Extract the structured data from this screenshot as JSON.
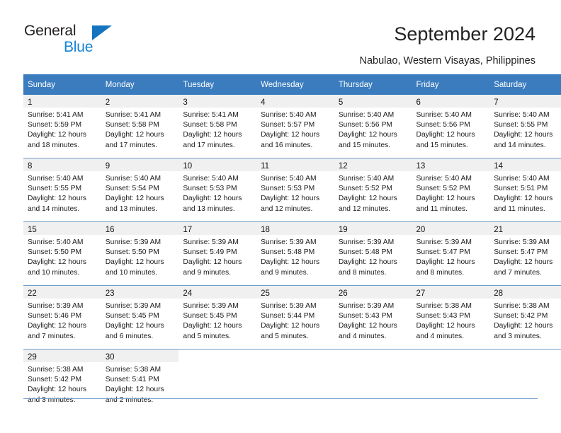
{
  "brand": {
    "name_dark": "General",
    "name_light": "Blue",
    "triangle_color": "#1673bd",
    "blue_color": "#1683d4"
  },
  "header": {
    "title": "September 2024",
    "subtitle": "Nabulao, Western Visayas, Philippines",
    "header_bg": "#3a7cbe",
    "header_text_color": "#ffffff",
    "daynum_band_bg": "#f0f0f0",
    "row_rule_color": "#6d9dcb"
  },
  "weekday_headers": [
    "Sunday",
    "Monday",
    "Tuesday",
    "Wednesday",
    "Thursday",
    "Friday",
    "Saturday"
  ],
  "weeks": [
    [
      {
        "day": "1",
        "l1": "Sunrise: 5:41 AM",
        "l2": "Sunset: 5:59 PM",
        "l3": "Daylight: 12 hours",
        "l4": "and 18 minutes."
      },
      {
        "day": "2",
        "l1": "Sunrise: 5:41 AM",
        "l2": "Sunset: 5:58 PM",
        "l3": "Daylight: 12 hours",
        "l4": "and 17 minutes."
      },
      {
        "day": "3",
        "l1": "Sunrise: 5:41 AM",
        "l2": "Sunset: 5:58 PM",
        "l3": "Daylight: 12 hours",
        "l4": "and 17 minutes."
      },
      {
        "day": "4",
        "l1": "Sunrise: 5:40 AM",
        "l2": "Sunset: 5:57 PM",
        "l3": "Daylight: 12 hours",
        "l4": "and 16 minutes."
      },
      {
        "day": "5",
        "l1": "Sunrise: 5:40 AM",
        "l2": "Sunset: 5:56 PM",
        "l3": "Daylight: 12 hours",
        "l4": "and 15 minutes."
      },
      {
        "day": "6",
        "l1": "Sunrise: 5:40 AM",
        "l2": "Sunset: 5:56 PM",
        "l3": "Daylight: 12 hours",
        "l4": "and 15 minutes."
      },
      {
        "day": "7",
        "l1": "Sunrise: 5:40 AM",
        "l2": "Sunset: 5:55 PM",
        "l3": "Daylight: 12 hours",
        "l4": "and 14 minutes."
      }
    ],
    [
      {
        "day": "8",
        "l1": "Sunrise: 5:40 AM",
        "l2": "Sunset: 5:55 PM",
        "l3": "Daylight: 12 hours",
        "l4": "and 14 minutes."
      },
      {
        "day": "9",
        "l1": "Sunrise: 5:40 AM",
        "l2": "Sunset: 5:54 PM",
        "l3": "Daylight: 12 hours",
        "l4": "and 13 minutes."
      },
      {
        "day": "10",
        "l1": "Sunrise: 5:40 AM",
        "l2": "Sunset: 5:53 PM",
        "l3": "Daylight: 12 hours",
        "l4": "and 13 minutes."
      },
      {
        "day": "11",
        "l1": "Sunrise: 5:40 AM",
        "l2": "Sunset: 5:53 PM",
        "l3": "Daylight: 12 hours",
        "l4": "and 12 minutes."
      },
      {
        "day": "12",
        "l1": "Sunrise: 5:40 AM",
        "l2": "Sunset: 5:52 PM",
        "l3": "Daylight: 12 hours",
        "l4": "and 12 minutes."
      },
      {
        "day": "13",
        "l1": "Sunrise: 5:40 AM",
        "l2": "Sunset: 5:52 PM",
        "l3": "Daylight: 12 hours",
        "l4": "and 11 minutes."
      },
      {
        "day": "14",
        "l1": "Sunrise: 5:40 AM",
        "l2": "Sunset: 5:51 PM",
        "l3": "Daylight: 12 hours",
        "l4": "and 11 minutes."
      }
    ],
    [
      {
        "day": "15",
        "l1": "Sunrise: 5:40 AM",
        "l2": "Sunset: 5:50 PM",
        "l3": "Daylight: 12 hours",
        "l4": "and 10 minutes."
      },
      {
        "day": "16",
        "l1": "Sunrise: 5:39 AM",
        "l2": "Sunset: 5:50 PM",
        "l3": "Daylight: 12 hours",
        "l4": "and 10 minutes."
      },
      {
        "day": "17",
        "l1": "Sunrise: 5:39 AM",
        "l2": "Sunset: 5:49 PM",
        "l3": "Daylight: 12 hours",
        "l4": "and 9 minutes."
      },
      {
        "day": "18",
        "l1": "Sunrise: 5:39 AM",
        "l2": "Sunset: 5:48 PM",
        "l3": "Daylight: 12 hours",
        "l4": "and 9 minutes."
      },
      {
        "day": "19",
        "l1": "Sunrise: 5:39 AM",
        "l2": "Sunset: 5:48 PM",
        "l3": "Daylight: 12 hours",
        "l4": "and 8 minutes."
      },
      {
        "day": "20",
        "l1": "Sunrise: 5:39 AM",
        "l2": "Sunset: 5:47 PM",
        "l3": "Daylight: 12 hours",
        "l4": "and 8 minutes."
      },
      {
        "day": "21",
        "l1": "Sunrise: 5:39 AM",
        "l2": "Sunset: 5:47 PM",
        "l3": "Daylight: 12 hours",
        "l4": "and 7 minutes."
      }
    ],
    [
      {
        "day": "22",
        "l1": "Sunrise: 5:39 AM",
        "l2": "Sunset: 5:46 PM",
        "l3": "Daylight: 12 hours",
        "l4": "and 7 minutes."
      },
      {
        "day": "23",
        "l1": "Sunrise: 5:39 AM",
        "l2": "Sunset: 5:45 PM",
        "l3": "Daylight: 12 hours",
        "l4": "and 6 minutes."
      },
      {
        "day": "24",
        "l1": "Sunrise: 5:39 AM",
        "l2": "Sunset: 5:45 PM",
        "l3": "Daylight: 12 hours",
        "l4": "and 5 minutes."
      },
      {
        "day": "25",
        "l1": "Sunrise: 5:39 AM",
        "l2": "Sunset: 5:44 PM",
        "l3": "Daylight: 12 hours",
        "l4": "and 5 minutes."
      },
      {
        "day": "26",
        "l1": "Sunrise: 5:39 AM",
        "l2": "Sunset: 5:43 PM",
        "l3": "Daylight: 12 hours",
        "l4": "and 4 minutes."
      },
      {
        "day": "27",
        "l1": "Sunrise: 5:38 AM",
        "l2": "Sunset: 5:43 PM",
        "l3": "Daylight: 12 hours",
        "l4": "and 4 minutes."
      },
      {
        "day": "28",
        "l1": "Sunrise: 5:38 AM",
        "l2": "Sunset: 5:42 PM",
        "l3": "Daylight: 12 hours",
        "l4": "and 3 minutes."
      }
    ],
    [
      {
        "day": "29",
        "l1": "Sunrise: 5:38 AM",
        "l2": "Sunset: 5:42 PM",
        "l3": "Daylight: 12 hours",
        "l4": "and 3 minutes."
      },
      {
        "day": "30",
        "l1": "Sunrise: 5:38 AM",
        "l2": "Sunset: 5:41 PM",
        "l3": "Daylight: 12 hours",
        "l4": "and 2 minutes."
      },
      {
        "day": "",
        "l1": "",
        "l2": "",
        "l3": "",
        "l4": ""
      },
      {
        "day": "",
        "l1": "",
        "l2": "",
        "l3": "",
        "l4": ""
      },
      {
        "day": "",
        "l1": "",
        "l2": "",
        "l3": "",
        "l4": ""
      },
      {
        "day": "",
        "l1": "",
        "l2": "",
        "l3": "",
        "l4": ""
      },
      {
        "day": "",
        "l1": "",
        "l2": "",
        "l3": "",
        "l4": ""
      }
    ]
  ]
}
